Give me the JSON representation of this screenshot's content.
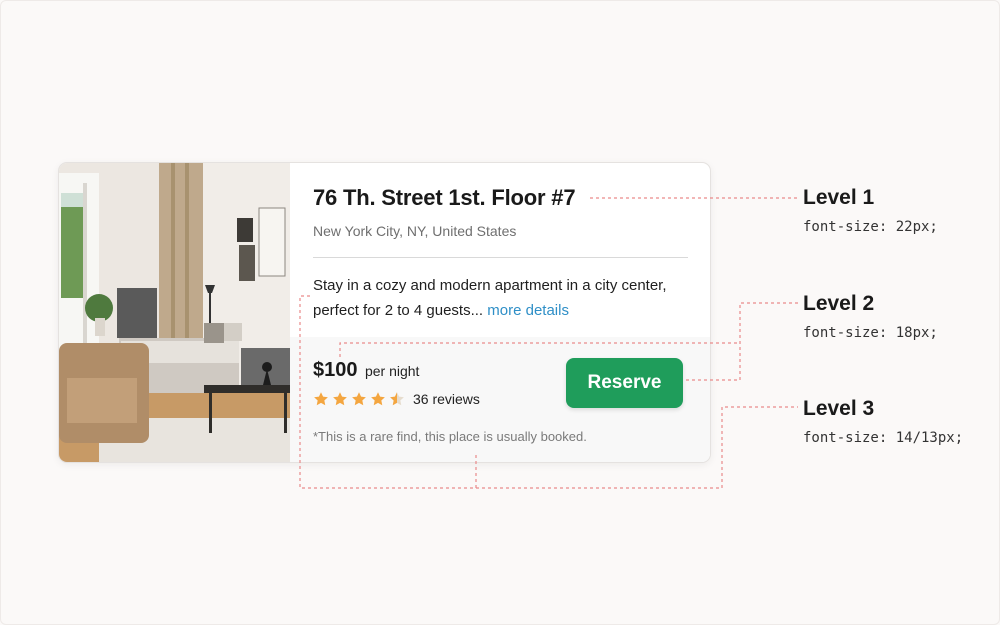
{
  "listing": {
    "title": "76 Th. Street 1st. Floor #7",
    "location": "New York City, NY, United States",
    "description": "Stay in a cozy and modern apartment in a city center, perfect for 2 to 4 guests...",
    "more_link": "more details",
    "price": "$100",
    "price_unit": "per night",
    "rating": 4.5,
    "rating_max": 5,
    "reviews": "36 reviews",
    "note": "*This is a rare find, this place is usually booked.",
    "reserve_label": "Reserve"
  },
  "annotations": [
    {
      "title": "Level 1",
      "font_size": "font-size: 22px;"
    },
    {
      "title": "Level 2",
      "font_size": "font-size: 18px;"
    },
    {
      "title": "Level 3",
      "font_size": "font-size: 14/13px;"
    }
  ],
  "colors": {
    "accent_green": "#1f9d5b",
    "link_blue": "#2f8fc7",
    "star_orange": "#f4a640",
    "annotation_red": "#e98a8a"
  },
  "icons": {
    "star": "star-icon",
    "half_star": "star-half-icon"
  }
}
